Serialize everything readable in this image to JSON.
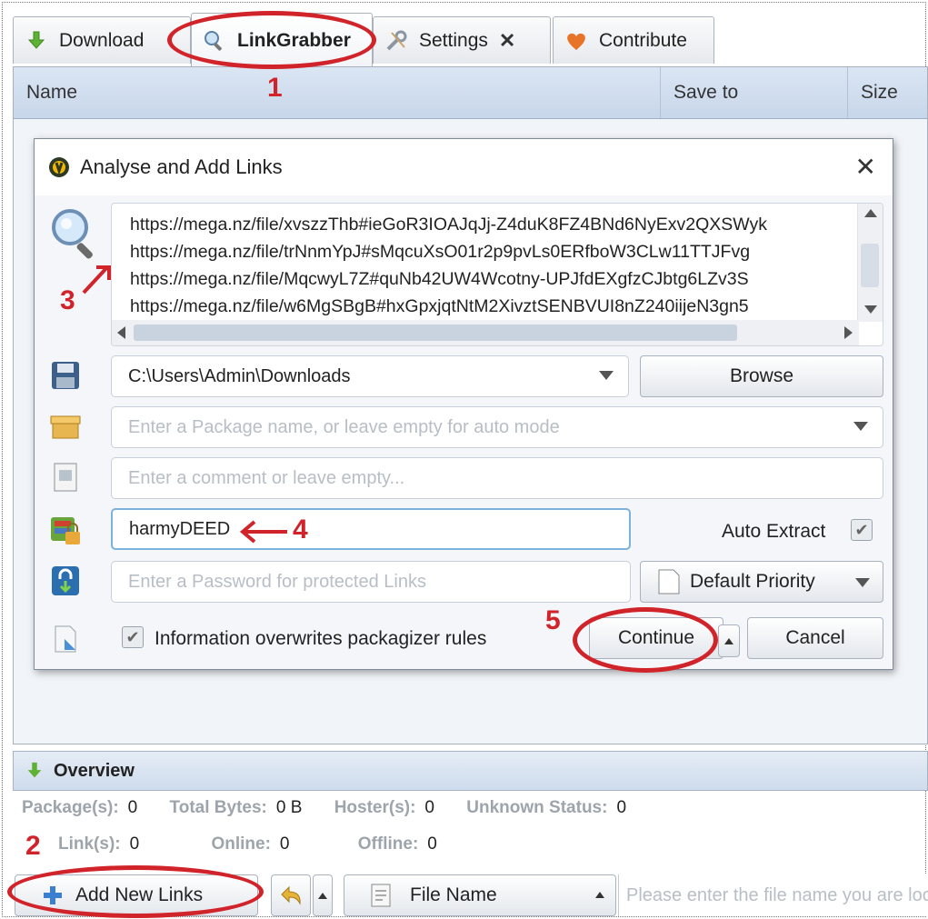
{
  "tabs": [
    {
      "label": "Download",
      "icon": "download-arrow-icon"
    },
    {
      "label": "LinkGrabber",
      "icon": "magnifier-icon"
    },
    {
      "label": "Settings",
      "icon": "wrench-icon",
      "close": "✕"
    },
    {
      "label": "Contribute",
      "icon": "heart-icon"
    }
  ],
  "columns": {
    "name": "Name",
    "save_to": "Save to",
    "size": "Size"
  },
  "dialog": {
    "title": "Analyse and Add Links",
    "close": "✕",
    "links": [
      "https://mega.nz/file/xvszzThb#ieGoR3IOAJqJj-Z4duK8FZ4BNd6NyExv2QXSWyk",
      "https://mega.nz/file/trNnmYpJ#sMqcuXsO01r2p9pvLs0ERfboW3CLw11TTJFvg",
      "https://mega.nz/file/MqcwyL7Z#quNb42UW4Wcotny-UPJfdEXgfzCJbtg6LZv3S",
      "https://mega.nz/file/w6MgSBgB#hxGpxjqtNtM2XivztSENBVUI8nZ240iijeN3gn5"
    ],
    "save_path": "C:\\Users\\Admin\\Downloads",
    "browse_label": "Browse",
    "package_placeholder": "Enter a Package name, or leave empty for auto mode",
    "comment_placeholder": "Enter a comment or leave empty...",
    "extract_password": "harmyDEED",
    "auto_extract_label": "Auto Extract",
    "auto_extract_checked": true,
    "link_password_placeholder": "Enter a Password for protected Links",
    "priority_label": "Default Priority",
    "overwrite_label": "Information overwrites packagizer rules",
    "overwrite_checked": true,
    "continue_label": "Continue",
    "cancel_label": "Cancel"
  },
  "overview": {
    "title": "Overview",
    "stats_row1": [
      {
        "label": "Package(s):",
        "value": "0"
      },
      {
        "label": "Total Bytes:",
        "value": "0 B"
      },
      {
        "label": "Hoster(s):",
        "value": "0"
      },
      {
        "label": "Unknown Status:",
        "value": "0"
      }
    ],
    "stats_row2": [
      {
        "label": "Link(s):",
        "value": "0"
      },
      {
        "label": "Online:",
        "value": "0"
      },
      {
        "label": "Offline:",
        "value": "0"
      }
    ]
  },
  "bottom": {
    "add_links_label": "Add New Links",
    "file_name_label": "File Name",
    "filter_placeholder": "Please enter the file name you are looking for..."
  },
  "annotations": {
    "n1": "1",
    "n2": "2",
    "n3": "3",
    "n4": "4",
    "n5": "5",
    "accent": "#d1232a"
  }
}
